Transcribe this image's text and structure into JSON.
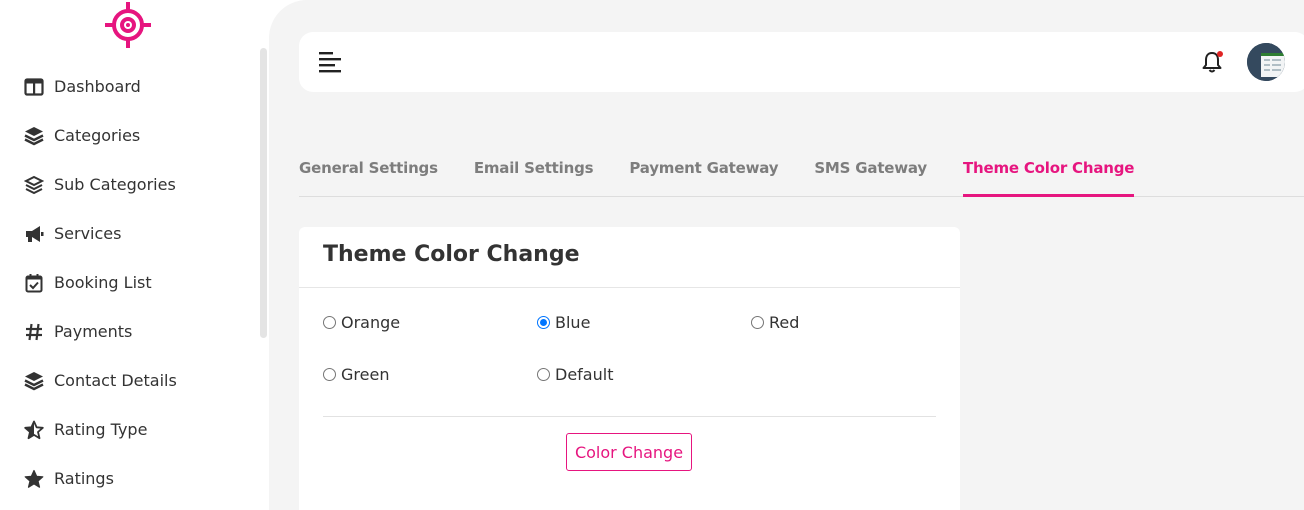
{
  "brand": {
    "accent_color": "#e6157f",
    "logo_icon": "crosshair-target-icon"
  },
  "sidebar": {
    "items": [
      {
        "label": "Dashboard",
        "icon": "layout-columns-icon"
      },
      {
        "label": "Categories",
        "icon": "layers-icon"
      },
      {
        "label": "Sub Categories",
        "icon": "layers-outline-icon"
      },
      {
        "label": "Services",
        "icon": "megaphone-icon"
      },
      {
        "label": "Booking List",
        "icon": "calendar-check-icon"
      },
      {
        "label": "Payments",
        "icon": "hash-icon"
      },
      {
        "label": "Contact Details",
        "icon": "layers-icon"
      },
      {
        "label": "Rating Type",
        "icon": "star-half-icon"
      },
      {
        "label": "Ratings",
        "icon": "star-icon"
      }
    ]
  },
  "topbar": {
    "menu_icon": "menu-icon",
    "bell_icon": "bell-icon",
    "avatar_icon": "avatar"
  },
  "tabs": [
    {
      "label": "General Settings",
      "active": false
    },
    {
      "label": "Email Settings",
      "active": false
    },
    {
      "label": "Payment Gateway",
      "active": false
    },
    {
      "label": "SMS Gateway",
      "active": false
    },
    {
      "label": "Theme Color Change",
      "active": true
    }
  ],
  "card": {
    "title": "Theme Color Change",
    "options": [
      {
        "label": "Orange",
        "checked": false
      },
      {
        "label": "Blue",
        "checked": true
      },
      {
        "label": "Red",
        "checked": false
      },
      {
        "label": "Green",
        "checked": false
      },
      {
        "label": "Default",
        "checked": false
      }
    ],
    "submit_label": "Color Change"
  }
}
